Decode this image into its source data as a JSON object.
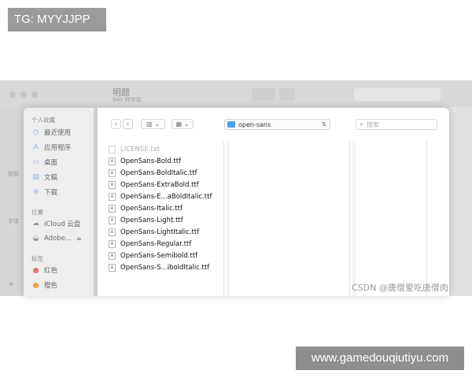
{
  "overlay": {
    "top_tag": "TG: MYYJJPP",
    "bottom_tag": "www.gamedouqiutiyu.com",
    "watermark": "CSDN @唐僧爱吃唐僧肉"
  },
  "background_window": {
    "title": "明题",
    "subtitle": "940 种字体",
    "side_labels": [
      "智能",
      "字体",
      "+"
    ]
  },
  "dialog": {
    "sidebar": {
      "favorites_header": "个人收藏",
      "favorites": [
        {
          "label": "最近使用",
          "icon": "clock-icon"
        },
        {
          "label": "应用程序",
          "icon": "apps-icon"
        },
        {
          "label": "桌面",
          "icon": "desktop-icon"
        },
        {
          "label": "文稿",
          "icon": "document-icon"
        },
        {
          "label": "下载",
          "icon": "download-icon"
        }
      ],
      "locations_header": "位置",
      "locations": [
        {
          "label": "iCloud 云盘",
          "icon": "cloud-icon"
        },
        {
          "label": "Adobe...",
          "icon": "disk-icon"
        }
      ],
      "tags_header": "标签",
      "tags": [
        {
          "label": "红色",
          "color": "#e8706b"
        },
        {
          "label": "橙色",
          "color": "#f0a04a"
        }
      ]
    },
    "toolbar": {
      "location": "open-sans",
      "search_placeholder": "搜索"
    },
    "files": [
      {
        "name": "LICENSE.txt",
        "enabled": false
      },
      {
        "name": "OpenSans-Bold.ttf",
        "enabled": true
      },
      {
        "name": "OpenSans-BoldItalic.ttf",
        "enabled": true
      },
      {
        "name": "OpenSans-ExtraBold.ttf",
        "enabled": true
      },
      {
        "name": "OpenSans-E...aBoldItalic.ttf",
        "enabled": true
      },
      {
        "name": "OpenSans-Italic.ttf",
        "enabled": true
      },
      {
        "name": "OpenSans-Light.ttf",
        "enabled": true
      },
      {
        "name": "OpenSans-LightItalic.ttf",
        "enabled": true
      },
      {
        "name": "OpenSans-Regular.ttf",
        "enabled": true
      },
      {
        "name": "OpenSans-Semibold.ttf",
        "enabled": true
      },
      {
        "name": "OpenSans-S...iboldItalic.ttf",
        "enabled": true
      }
    ]
  }
}
